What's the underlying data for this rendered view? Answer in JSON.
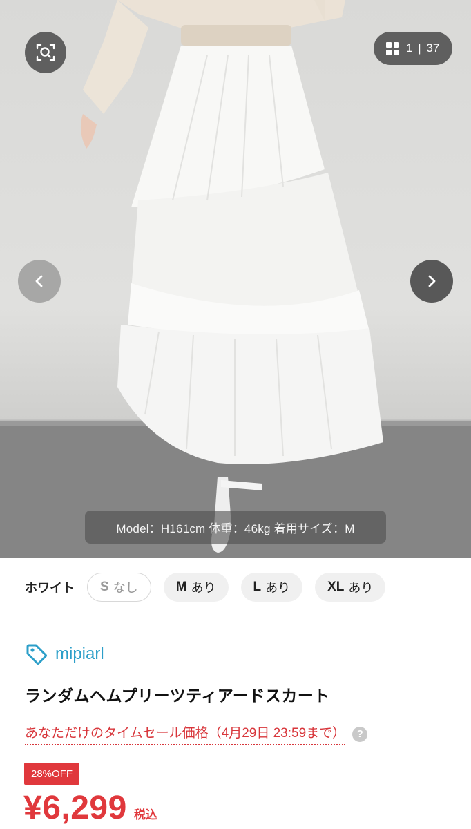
{
  "gallery": {
    "counter_current": "1",
    "counter_sep": "|",
    "counter_total": "37",
    "caption": "Model：H161cm 体重：46kg 着用サイズ：M",
    "icons": [
      "search-zoom-icon",
      "grid-icon",
      "chevron-left-icon",
      "chevron-right-icon"
    ]
  },
  "sizes": {
    "color_label": "ホワイト",
    "options": [
      {
        "size": "S",
        "stock": "なし",
        "available": false
      },
      {
        "size": "M",
        "stock": "あり",
        "available": true
      },
      {
        "size": "L",
        "stock": "あり",
        "available": true
      },
      {
        "size": "XL",
        "stock": "あり",
        "available": true
      }
    ]
  },
  "product": {
    "brand": "mipiarl",
    "title": "ランダムヘムプリーツティアードスカート",
    "sale_text": "あなただけのタイムセール価格（4月29日 23:59まで）",
    "help_symbol": "?",
    "discount_badge": "28%OFF",
    "price": "¥6,299",
    "tax_label": "税込"
  },
  "colors": {
    "accent_red": "#e0383c",
    "brand_blue": "#2c9fc9"
  }
}
